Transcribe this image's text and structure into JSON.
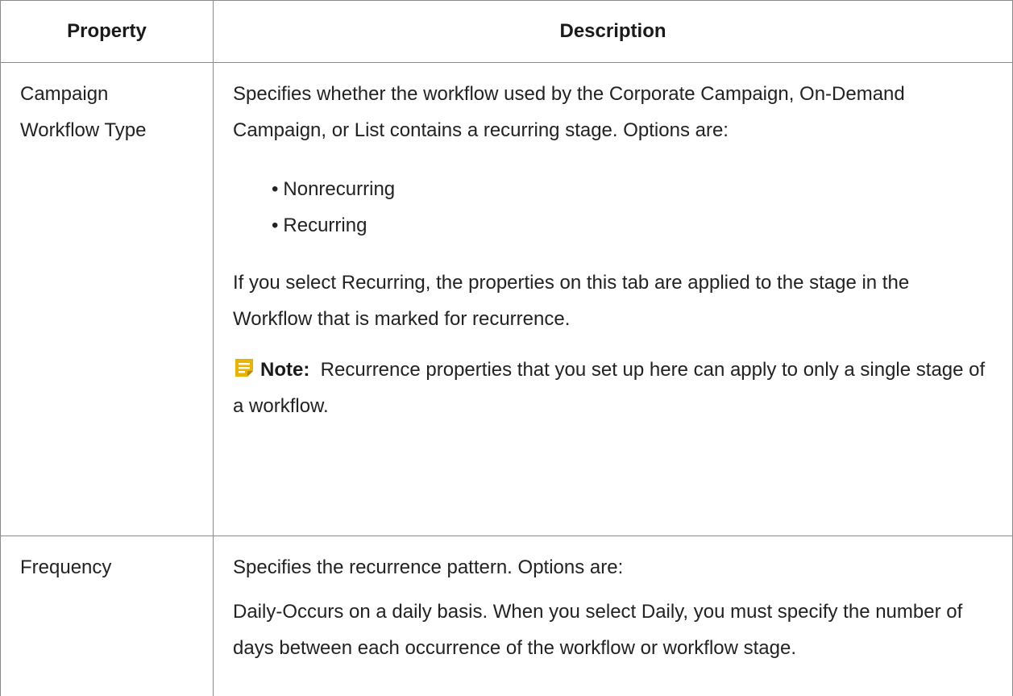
{
  "table": {
    "header": {
      "property": "Property",
      "description": "Description"
    },
    "rows": [
      {
        "property": "Campaign Workflow Type",
        "description": "Specifies whether the workflow used by the Corporate Campaign, On-Demand Campaign, or List contains a recurring stage. Options are:",
        "options": [
          "Nonrecurring",
          "Recurring"
        ],
        "detail": "If you select Recurring, the properties on this tab are applied to the stage in the Workflow that is marked for recurrence.",
        "note": {
          "icon": "note-icon",
          "label": "Note:",
          "text": "Recurrence properties that you set up here can apply to only a single stage of a workflow."
        }
      },
      {
        "property": "Frequency",
        "description": "Specifies the recurrence pattern. Options are:",
        "detail": "Daily-Occurs on a daily basis. When you select Daily, you must specify the number of days between each occurrence of the workflow or workflow stage."
      }
    ]
  },
  "colors": {
    "border": "#8a8a8a",
    "note_icon": "#e8b400",
    "text": "#222222"
  }
}
